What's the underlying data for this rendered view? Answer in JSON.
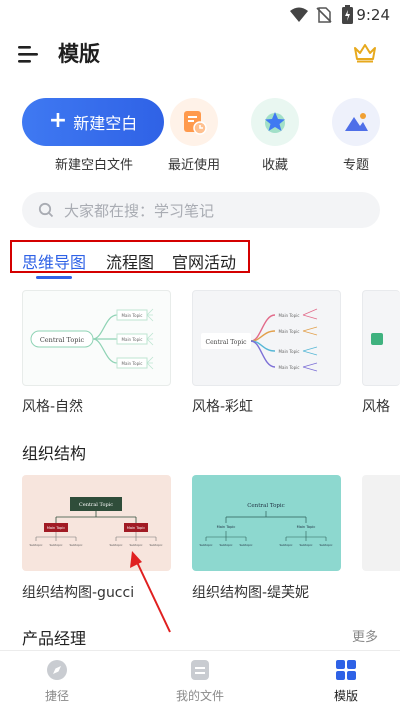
{
  "status_bar": {
    "time": "9:24"
  },
  "header": {
    "title": "模版"
  },
  "quick_actions": [
    {
      "label": "新建空白文件",
      "button_text": "新建空白"
    },
    {
      "label": "最近使用",
      "icon": "recent-icon"
    },
    {
      "label": "收藏",
      "icon": "star-icon"
    },
    {
      "label": "专题",
      "icon": "mountain-icon"
    }
  ],
  "search": {
    "placeholder": "大家都在搜：学习笔记"
  },
  "tabs": [
    {
      "label": "思维导图",
      "active": true
    },
    {
      "label": "流程图",
      "active": false
    },
    {
      "label": "官网活动",
      "active": false
    }
  ],
  "mind_map_templates": [
    {
      "name": "风格-自然",
      "central": "Central Topic",
      "main": "Main Topic",
      "sub": "Subtopic"
    },
    {
      "name": "风格-彩虹",
      "central": "Central Topic",
      "main": "Main Topic",
      "sub": "Subtopic"
    },
    {
      "name": "风格"
    }
  ],
  "org_section": {
    "title": "组织结构",
    "templates": [
      {
        "name": "组织结构图-gucci",
        "central": "Central Topic",
        "main": "Main Topic",
        "sub": "Subtopic"
      },
      {
        "name": "组织结构图-缇芙妮",
        "central": "Central Topic",
        "main": "Main Topic",
        "sub": "Subtopic"
      }
    ]
  },
  "pm_section": {
    "title": "产品经理",
    "more": "更多"
  },
  "bottom_nav": [
    {
      "label": "捷径",
      "icon": "compass-icon",
      "active": false
    },
    {
      "label": "我的文件",
      "icon": "file-icon",
      "active": false
    },
    {
      "label": "模版",
      "icon": "grid-icon",
      "active": true
    }
  ],
  "colors": {
    "accent": "#2f62e6",
    "highlight_box": "#d40000",
    "arrow": "#e02020"
  }
}
